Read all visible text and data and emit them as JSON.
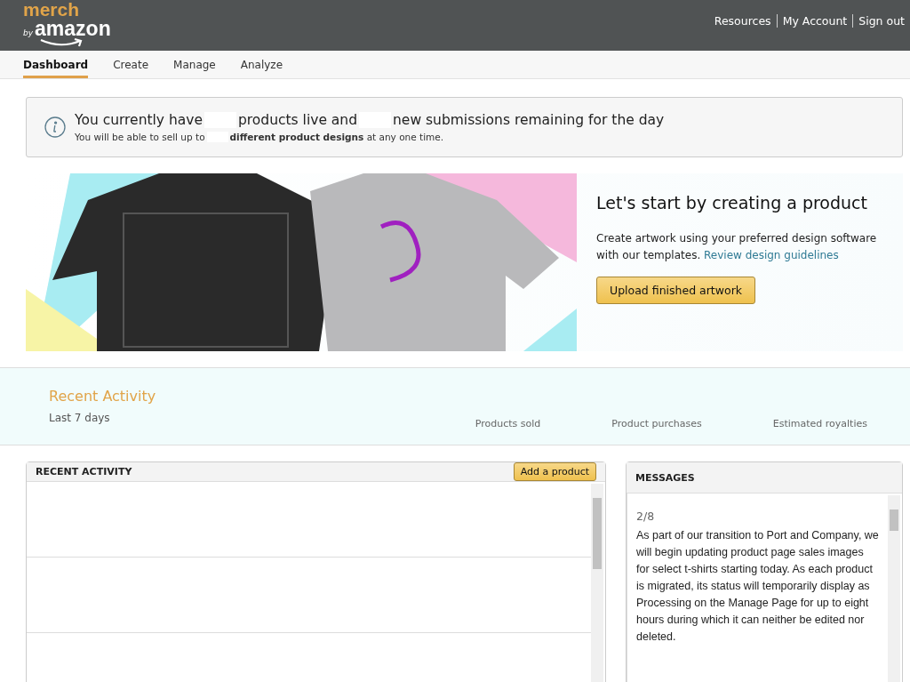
{
  "header": {
    "logo": {
      "merch": "merch",
      "by": "by",
      "amazon": "amazon"
    },
    "links": [
      "Resources",
      "My Account",
      "Sign out"
    ]
  },
  "tabs": [
    {
      "label": "Dashboard",
      "selected": true
    },
    {
      "label": "Create",
      "selected": false
    },
    {
      "label": "Manage",
      "selected": false
    },
    {
      "label": "Analyze",
      "selected": false
    }
  ],
  "notice": {
    "line_parts": [
      "You currently have",
      "products live and",
      "new submissions remaining for the day"
    ],
    "sub_parts": [
      "You will be able to sell up to",
      "**different product designs** at any one time."
    ]
  },
  "hero": {
    "title": "Let's start by creating a product",
    "text": "Create artwork using your preferred design software with our templates.",
    "link": "Review design guidelines",
    "button": "Upload finished artwork"
  },
  "summary": {
    "title": "Recent Activity",
    "period": "Last 7 days",
    "metrics": [
      "Products sold",
      "Product purchases",
      "Estimated royalties"
    ]
  },
  "activity": {
    "title": "RECENT ACTIVITY",
    "button": "Add a product"
  },
  "messages": {
    "title": "MESSAGES",
    "counter": "2/8",
    "body": "As part of our transition to Port and Company, we will begin updating product page sales images for select t-shirts starting today. As each product is migrated, its status will temporarily display as Processing on the Manage Page for up to eight hours during which it can neither be edited nor deleted."
  }
}
